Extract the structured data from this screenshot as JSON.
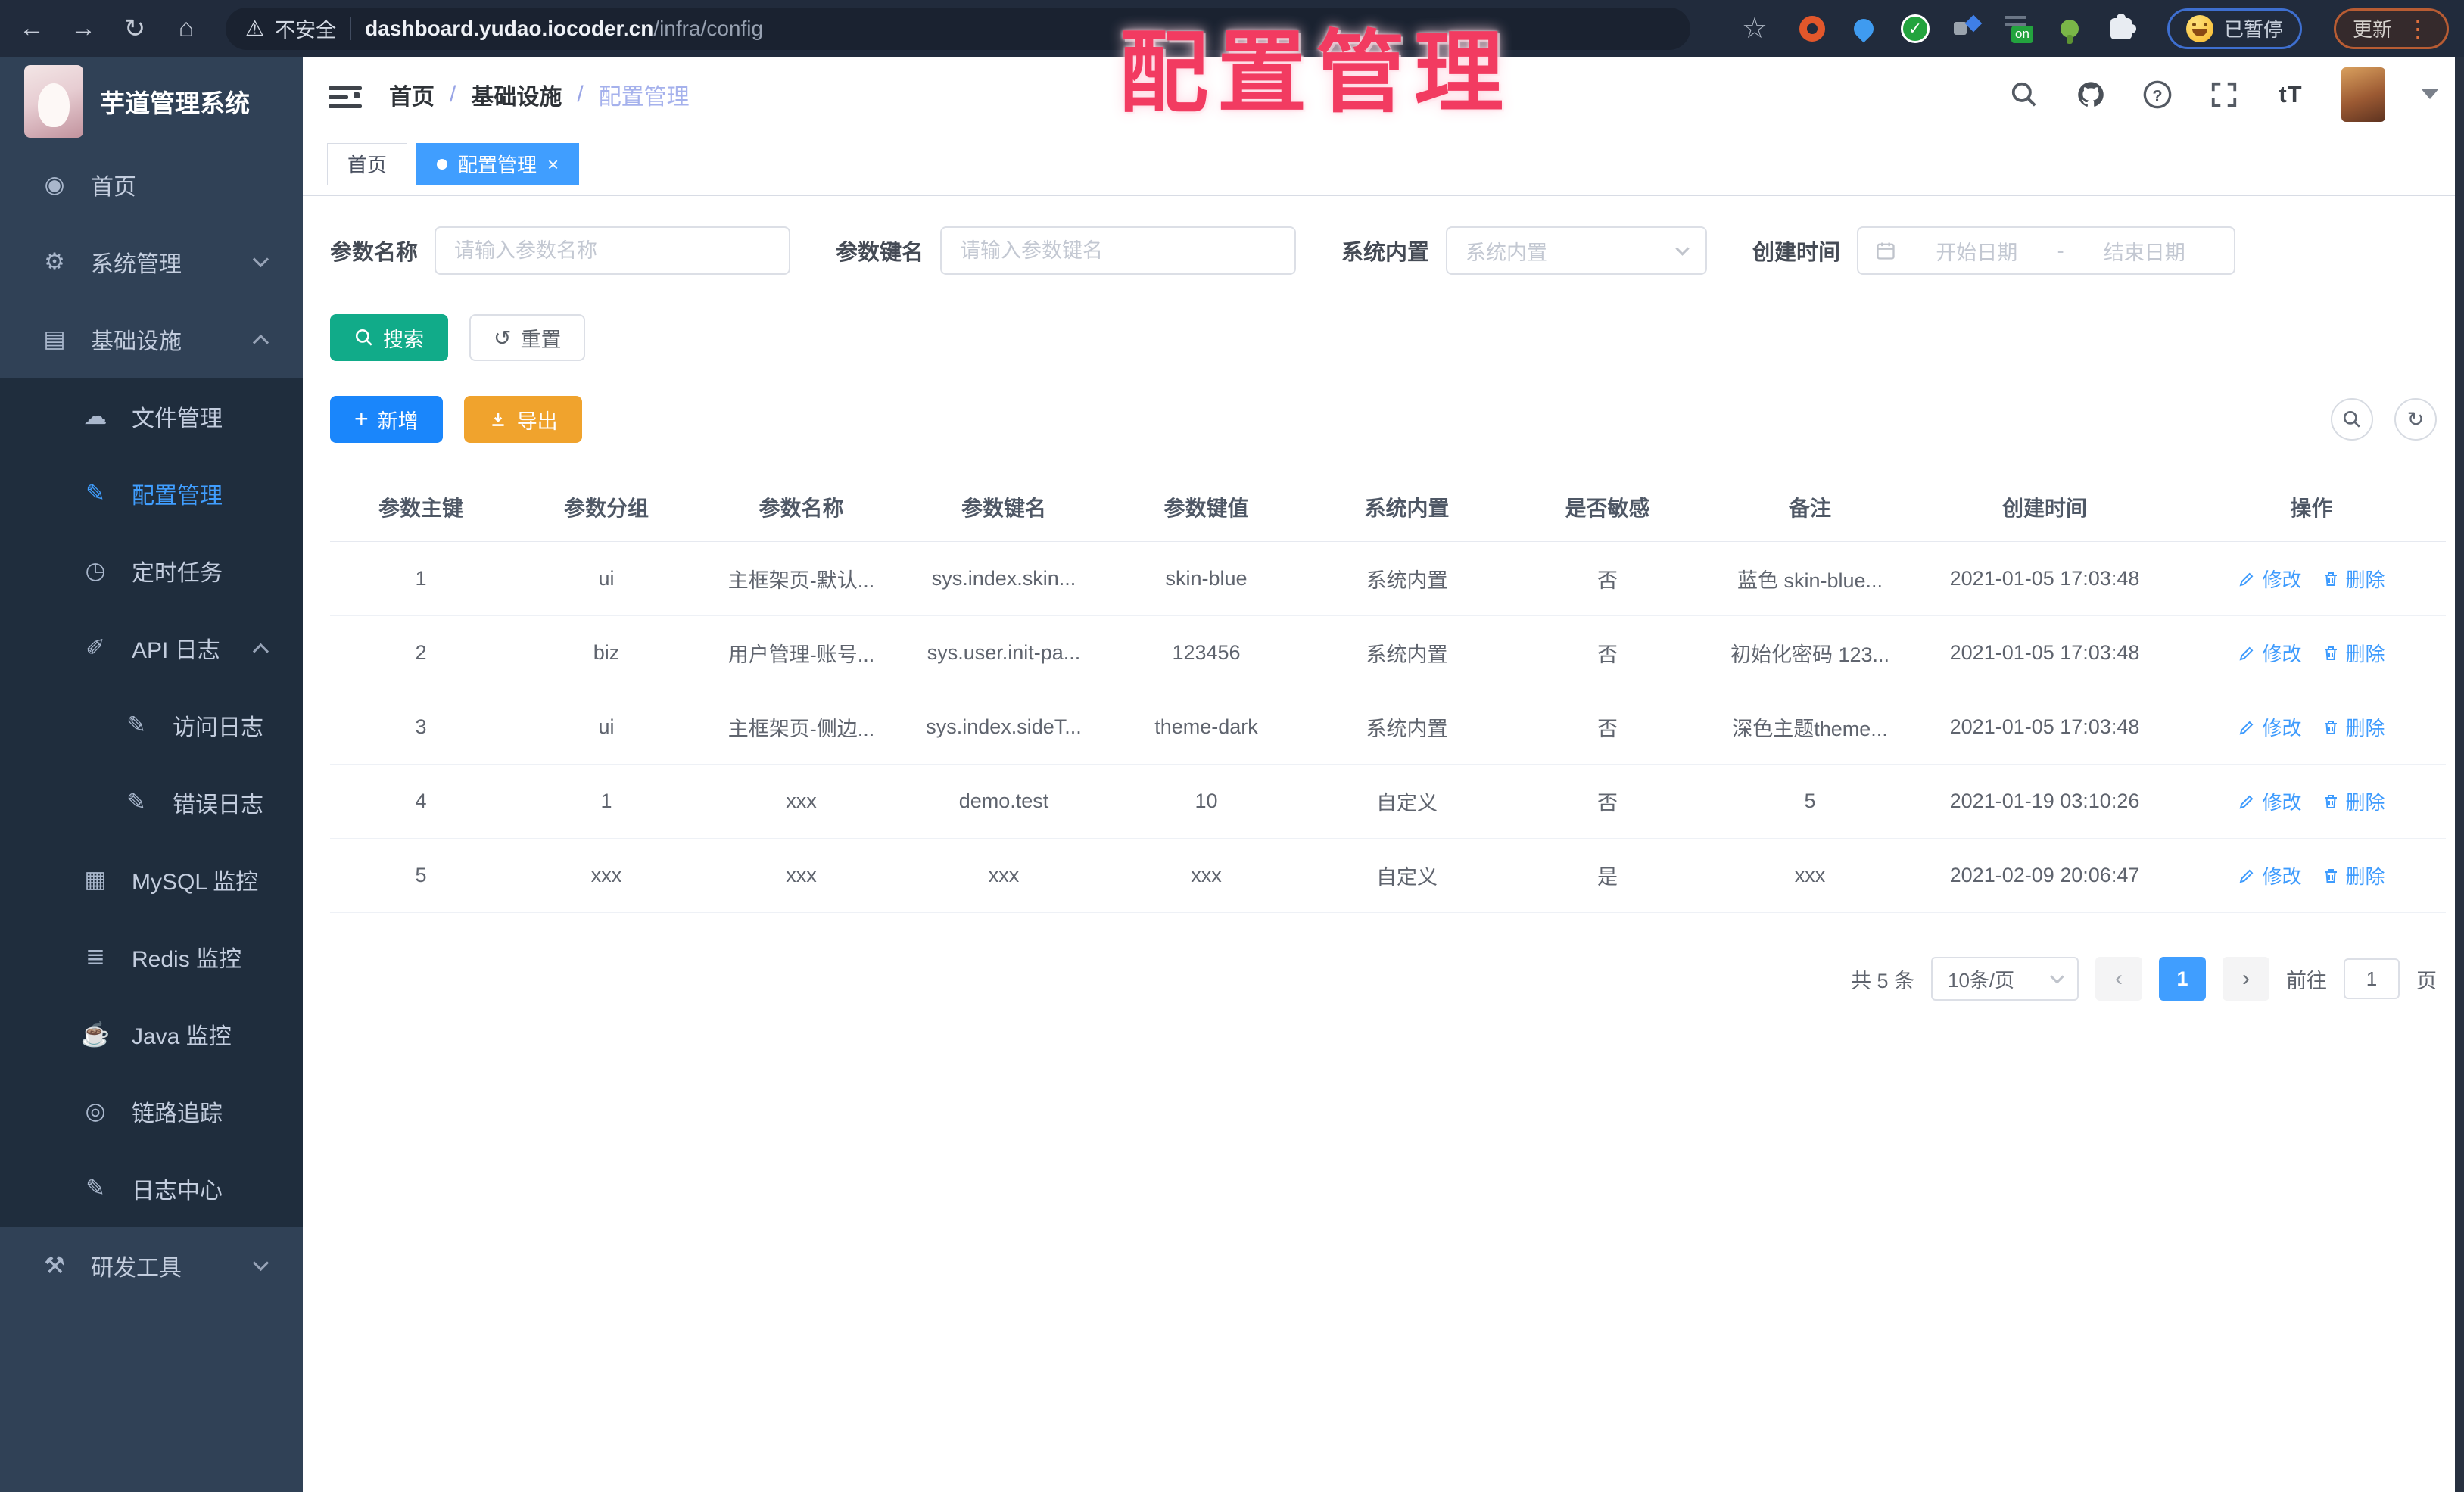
{
  "browser": {
    "security_label": "不安全",
    "url_domain": "dashboard.yudao.iocoder.cn",
    "url_path": "/infra/config",
    "paused_label": "已暂停",
    "update_label": "更新",
    "on_badge_text": "on",
    "extensions": [
      "orange-ring",
      "blue-pin",
      "green-check",
      "split-squares",
      "on-badge",
      "green-figure",
      "white-puzzle"
    ]
  },
  "overlay_title": "配置管理",
  "app": {
    "title": "芋道管理系统"
  },
  "breadcrumb": {
    "items": [
      "首页",
      "基础设施",
      "配置管理"
    ],
    "separator": "/"
  },
  "tabs": [
    {
      "label": "首页",
      "active": false
    },
    {
      "label": "配置管理",
      "active": true
    }
  ],
  "menu": {
    "icons": {
      "dashboard": "◉",
      "gear": "⚙",
      "infra": "▤",
      "cloud": "☁",
      "edit": "✎",
      "timer": "◷",
      "log": "✐",
      "doc": "✎",
      "mysql": "▦",
      "redis": "≣",
      "java": "☕",
      "trace": "◎",
      "logcenter": "✎",
      "tools": "⚒"
    },
    "items": [
      {
        "label": "首页",
        "icon": "dashboard",
        "level": 1
      },
      {
        "label": "系统管理",
        "icon": "gear",
        "level": 1,
        "arrow": "down"
      },
      {
        "label": "基础设施",
        "icon": "infra",
        "level": 1,
        "arrow": "up"
      },
      {
        "label": "文件管理",
        "icon": "cloud",
        "level": 2
      },
      {
        "label": "配置管理",
        "icon": "edit",
        "level": 2,
        "active": true
      },
      {
        "label": "定时任务",
        "icon": "timer",
        "level": 2
      },
      {
        "label": "API 日志",
        "icon": "log",
        "level": 2,
        "arrow": "up"
      },
      {
        "label": "访问日志",
        "icon": "doc",
        "level": 3
      },
      {
        "label": "错误日志",
        "icon": "doc",
        "level": 3
      },
      {
        "label": "MySQL 监控",
        "icon": "mysql",
        "level": 2
      },
      {
        "label": "Redis 监控",
        "icon": "redis",
        "level": 2
      },
      {
        "label": "Java 监控",
        "icon": "java",
        "level": 2
      },
      {
        "label": "链路追踪",
        "icon": "trace",
        "level": 2
      },
      {
        "label": "日志中心",
        "icon": "logcenter",
        "level": 2
      },
      {
        "label": "研发工具",
        "icon": "tools",
        "level": 1,
        "arrow": "down"
      }
    ]
  },
  "filters": {
    "name_label": "参数名称",
    "name_placeholder": "请输入参数名称",
    "key_label": "参数键名",
    "key_placeholder": "请输入参数键名",
    "builtin_label": "系统内置",
    "builtin_placeholder": "系统内置",
    "date_label": "创建时间",
    "date_start_placeholder": "开始日期",
    "date_separator": "-",
    "date_end_placeholder": "结束日期",
    "search_label": "搜索",
    "reset_label": "重置"
  },
  "toolbar": {
    "add_label": "新增",
    "export_label": "导出"
  },
  "table": {
    "headers": [
      "参数主键",
      "参数分组",
      "参数名称",
      "参数键名",
      "参数键值",
      "系统内置",
      "是否敏感",
      "备注",
      "创建时间",
      "操作"
    ],
    "rows": [
      [
        "1",
        "ui",
        "主框架页-默认...",
        "sys.index.skin...",
        "skin-blue",
        "系统内置",
        "否",
        "蓝色 skin-blue...",
        "2021-01-05 17:03:48"
      ],
      [
        "2",
        "biz",
        "用户管理-账号...",
        "sys.user.init-pa...",
        "123456",
        "系统内置",
        "否",
        "初始化密码 123...",
        "2021-01-05 17:03:48"
      ],
      [
        "3",
        "ui",
        "主框架页-侧边...",
        "sys.index.sideT...",
        "theme-dark",
        "系统内置",
        "否",
        "深色主题theme...",
        "2021-01-05 17:03:48"
      ],
      [
        "4",
        "1",
        "xxx",
        "demo.test",
        "10",
        "自定义",
        "否",
        "5",
        "2021-01-19 03:10:26"
      ],
      [
        "5",
        "xxx",
        "xxx",
        "xxx",
        "xxx",
        "自定义",
        "是",
        "xxx",
        "2021-02-09 20:06:47"
      ]
    ],
    "edit_label": "修改",
    "delete_label": "删除"
  },
  "pagination": {
    "total_label": "共 5 条",
    "page_size_label": "10条/页",
    "current_page": "1",
    "goto_label": "前往",
    "goto_value": "1",
    "page_unit_label": "页"
  },
  "colors": {
    "accent": "#409eff",
    "sidebar_bg": "#304156",
    "submenu_bg": "#1f2d3d",
    "search_button": "#11ab89",
    "add_button": "#1a86fb",
    "export_button": "#f0a32d",
    "overlay_text": "#f23b61",
    "chrome_bg": "#212b3c"
  }
}
